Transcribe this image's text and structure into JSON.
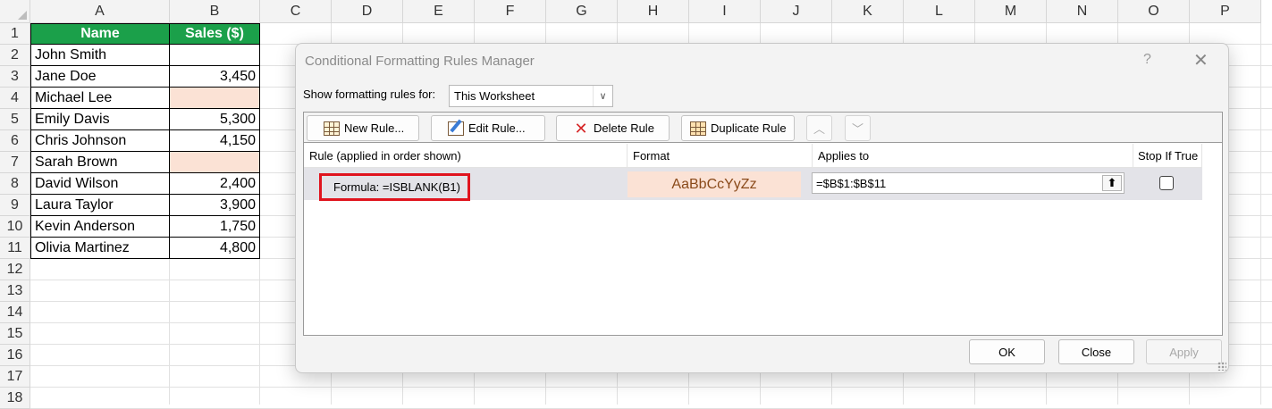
{
  "sheet": {
    "columns": [
      "A",
      "B",
      "C",
      "D",
      "E",
      "F",
      "G",
      "H",
      "I",
      "J",
      "K",
      "L",
      "M",
      "N",
      "O",
      "P"
    ],
    "rows": [
      "1",
      "2",
      "3",
      "4",
      "5",
      "6",
      "7",
      "8",
      "9",
      "10",
      "11",
      "12",
      "13",
      "14",
      "15",
      "16",
      "17",
      "18"
    ],
    "header": {
      "name": "Name",
      "sales": "Sales ($)"
    },
    "data": [
      {
        "name": "John Smith",
        "sales": "",
        "blank": false
      },
      {
        "name": "Jane Doe",
        "sales": "3,450",
        "blank": false
      },
      {
        "name": "Michael Lee",
        "sales": "",
        "blank": true
      },
      {
        "name": "Emily Davis",
        "sales": "5,300",
        "blank": false
      },
      {
        "name": "Chris Johnson",
        "sales": "4,150",
        "blank": false
      },
      {
        "name": "Sarah Brown",
        "sales": "",
        "blank": true
      },
      {
        "name": "David Wilson",
        "sales": "2,400",
        "blank": false
      },
      {
        "name": "Laura Taylor",
        "sales": "3,900",
        "blank": false
      },
      {
        "name": "Kevin Anderson",
        "sales": "1,750",
        "blank": false
      },
      {
        "name": "Olivia Martinez",
        "sales": "4,800",
        "blank": false
      }
    ],
    "colors": {
      "header_fill": "#1ba04a",
      "blank_fill": "#fbe2d5"
    }
  },
  "dialog": {
    "title": "Conditional Formatting Rules Manager",
    "help": "?",
    "close": "✕",
    "show_label": "Show formatting rules for:",
    "show_select": "This Worksheet",
    "toolbar": {
      "new_rule": "New Rule...",
      "edit_rule": "Edit Rule...",
      "delete_rule": "Delete Rule",
      "duplicate_rule": "Duplicate Rule",
      "move_up": "︿",
      "move_down": "﹀"
    },
    "columns": {
      "rule": "Rule (applied in order shown)",
      "format": "Format",
      "applies_to": "Applies to",
      "stop_if_true": "Stop If True"
    },
    "rule": {
      "text": "Formula: =ISBLANK(B1)",
      "format_preview": "AaBbCcYyZz",
      "applies_to": "=$B$1:$B$11",
      "stop_if_true": false
    },
    "buttons": {
      "ok": "OK",
      "close": "Close",
      "apply": "Apply"
    },
    "highlight_color": "#e0141e"
  }
}
